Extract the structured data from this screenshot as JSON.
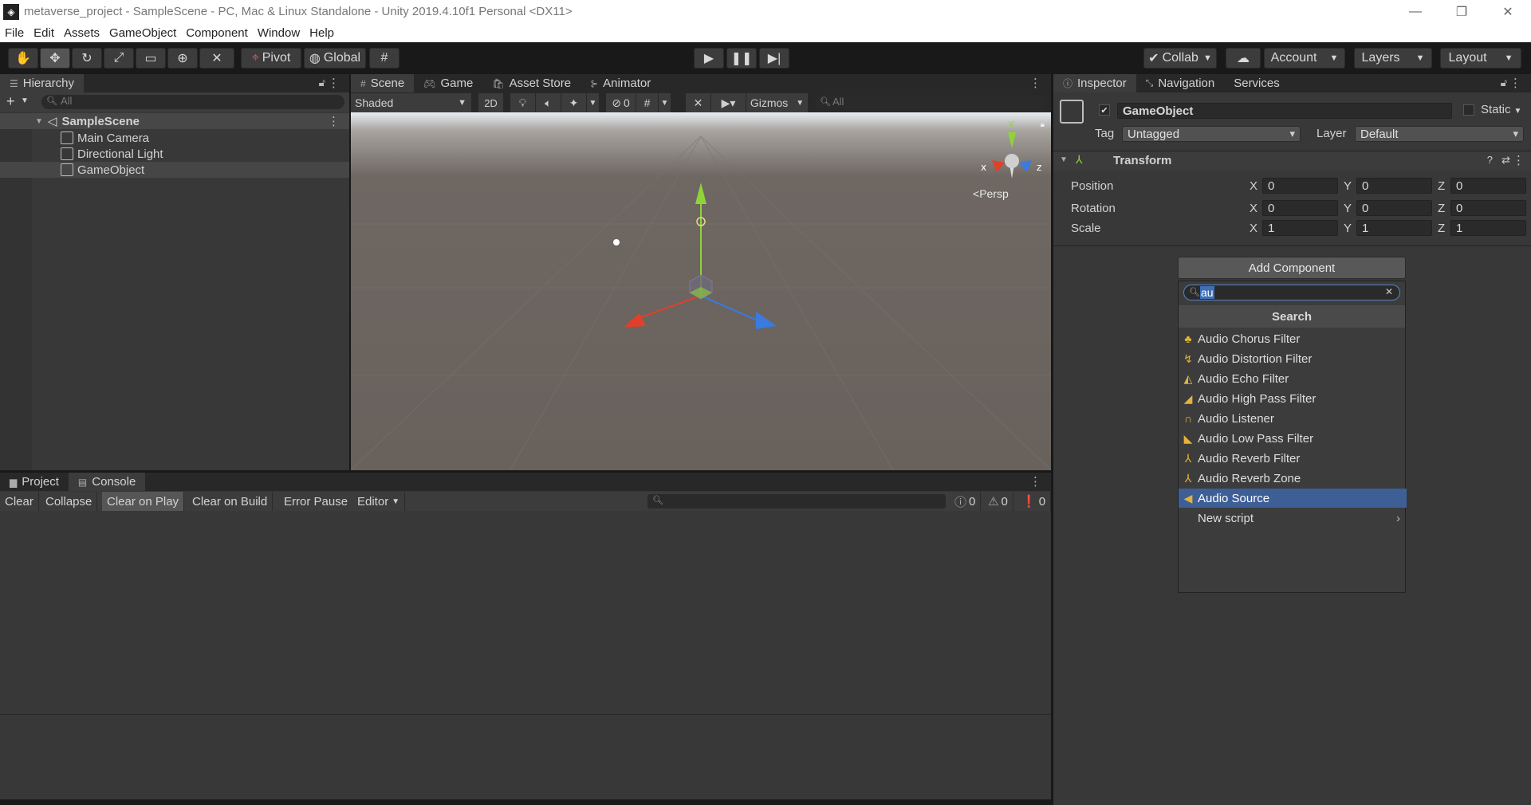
{
  "window": {
    "title": "metaverse_project - SampleScene - PC, Mac & Linux Standalone - Unity 2019.4.10f1 Personal <DX11>"
  },
  "menu": [
    "File",
    "Edit",
    "Assets",
    "GameObject",
    "Component",
    "Window",
    "Help"
  ],
  "toolbar": {
    "pivot": "Pivot",
    "global": "Global",
    "collab": "Collab",
    "account": "Account",
    "layers": "Layers",
    "layout": "Layout"
  },
  "hierarchy": {
    "tab": "Hierarchy",
    "search_placeholder": "All",
    "scene": "SampleScene",
    "items": [
      "Main Camera",
      "Directional Light",
      "GameObject"
    ]
  },
  "scene": {
    "tabs": [
      "Scene",
      "Game",
      "Asset Store",
      "Animator"
    ],
    "shading": "Shaded",
    "mode2d": "2D",
    "hidden_count": "0",
    "gizmos": "Gizmos",
    "search_placeholder": "All",
    "persp": "Persp",
    "axis_x": "x",
    "axis_y": "y",
    "axis_z": "z"
  },
  "console": {
    "tabs": [
      "Project",
      "Console"
    ],
    "buttons": [
      "Clear",
      "Collapse",
      "Clear on Play",
      "Clear on Build",
      "Error Pause",
      "Editor"
    ],
    "count_log": "0",
    "count_warn": "0",
    "count_error": "0"
  },
  "inspector": {
    "tabs": [
      "Inspector",
      "Navigation",
      "Services"
    ],
    "object_name": "GameObject",
    "static_label": "Static",
    "tag_label": "Tag",
    "tag_value": "Untagged",
    "layer_label": "Layer",
    "layer_value": "Default",
    "transform_title": "Transform",
    "rows": [
      {
        "label": "Position",
        "x": "0",
        "y": "0",
        "z": "0"
      },
      {
        "label": "Rotation",
        "x": "0",
        "y": "0",
        "z": "0"
      },
      {
        "label": "Scale",
        "x": "1",
        "y": "1",
        "z": "1"
      }
    ],
    "axis_x": "X",
    "axis_y": "Y",
    "axis_z": "Z",
    "add_component": "Add Component",
    "search_value": "au",
    "search_header": "Search",
    "results": [
      "Audio Chorus Filter",
      "Audio Distortion Filter",
      "Audio Echo Filter",
      "Audio High Pass Filter",
      "Audio Listener",
      "Audio Low Pass Filter",
      "Audio Reverb Filter",
      "Audio Reverb Zone",
      "Audio Source",
      "New script"
    ],
    "selected_result": "Audio Source"
  },
  "colors": {
    "accent_selection": "#3e5f96",
    "axis_x": "#e0402a",
    "axis_y": "#8fd33a",
    "axis_z": "#3a7be0",
    "icon_audio": "#e3b33c"
  }
}
